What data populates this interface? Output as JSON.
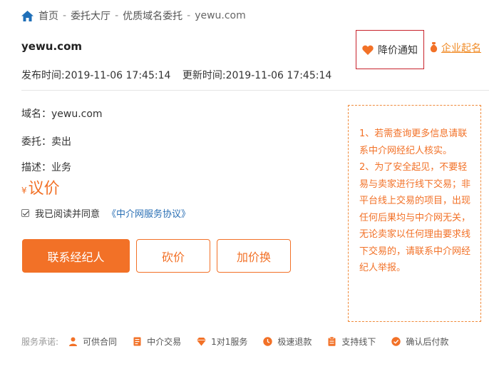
{
  "breadcrumb": {
    "home": "首页",
    "sep1": "-",
    "level2": "委托大厅",
    "sep2": "-",
    "level3": "优质域名委托",
    "sep3": "-",
    "current": "yewu.com"
  },
  "domain_title": "yewu.com",
  "actions": {
    "price_drop_notify": "降价通知",
    "enterprise_naming": "企业起名"
  },
  "times": {
    "published": "发布时间:2019-11-06 17:45:14",
    "updated": "更新时间:2019-11-06 17:45:14"
  },
  "info": {
    "domain": "域名：yewu.com",
    "entrust": "委托：卖出",
    "description": "描述：业务"
  },
  "price": {
    "currency_symbol": "¥",
    "value": "议价"
  },
  "agreement": {
    "text": "我已阅读并同意",
    "link": "《中介网服务协议》",
    "checked": true
  },
  "buttons": {
    "contact_agent": "联系经纪人",
    "bargain": "砍价",
    "raise_swap": "加价换"
  },
  "notice": {
    "p1": "1、若需查询更多信息请联系中介网经纪人核实。",
    "p2": "2、为了安全起见，不要轻易与卖家进行线下交易；非平台线上交易的项目，出现任何后果均与中介网无关，无论卖家以任何理由要求线下交易的，请联系中介网经纪人举报。"
  },
  "services": {
    "label": "服务承诺:",
    "items": [
      {
        "text": "可供合同",
        "icon": "person-icon"
      },
      {
        "text": "中介交易",
        "icon": "document-icon"
      },
      {
        "text": "1对1服务",
        "icon": "diamond-icon"
      },
      {
        "text": "极速退款",
        "icon": "clock-icon"
      },
      {
        "text": "支持线下",
        "icon": "clipboard-icon"
      },
      {
        "text": "确认后付款",
        "icon": "check-circle-icon"
      }
    ]
  },
  "colors": {
    "accent": "#f27127",
    "link": "#2a6fb4",
    "highlight_border": "#c8232c"
  }
}
